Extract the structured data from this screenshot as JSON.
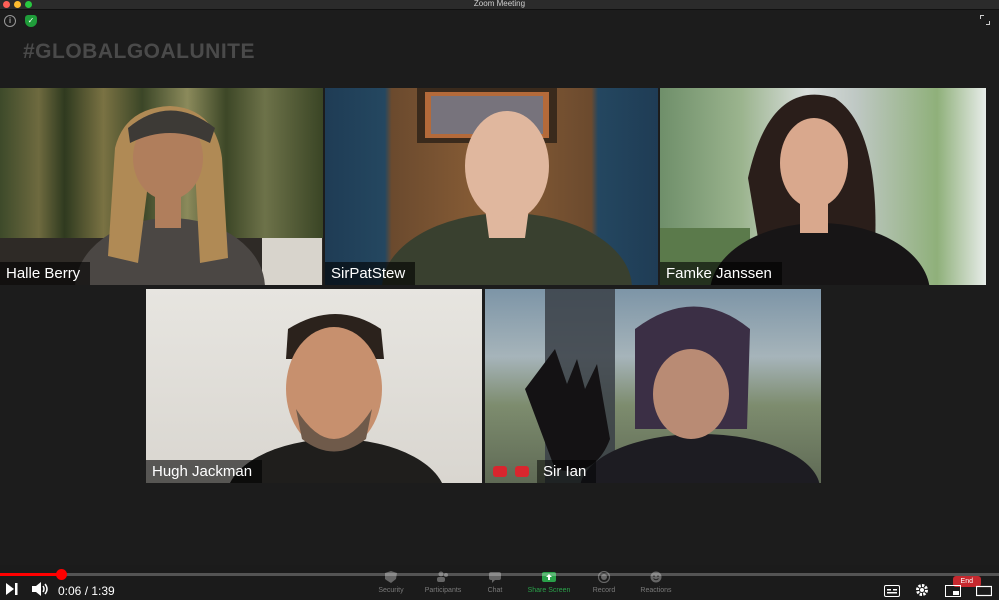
{
  "window": {
    "title": "Zoom Meeting"
  },
  "hashtag": "#GLOBALGOALUNITE",
  "participants": [
    {
      "name": "Halle Berry"
    },
    {
      "name": "SirPatStew"
    },
    {
      "name": "Famke Janssen"
    },
    {
      "name": "Hugh Jackman"
    },
    {
      "name": "Sir Ian"
    }
  ],
  "toolbar": {
    "security": "Security",
    "participants": "Participants",
    "chat": "Chat",
    "share_screen": "Share Screen",
    "record": "Record",
    "reactions": "Reactions",
    "end": "End"
  },
  "player": {
    "time": "0:06 / 1:39",
    "progress": 0.061
  },
  "colors": {
    "accent_green": "#2aa14a",
    "progress_red": "#ff0000",
    "mute_red": "#d9262e"
  }
}
